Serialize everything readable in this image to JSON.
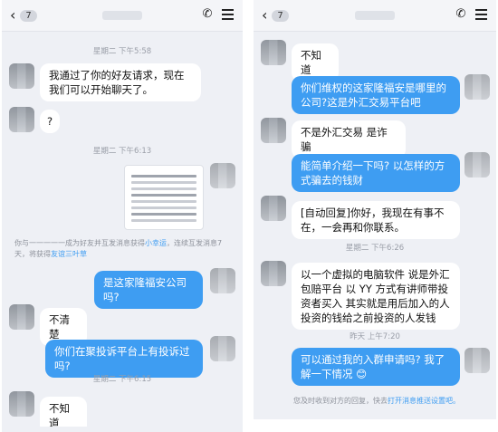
{
  "left": {
    "header": {
      "back_count": "7"
    },
    "timestamps": [
      "星期二 下午5:58",
      "星期二 下午6:13",
      "星期二 下午6:15"
    ],
    "messages": [
      "我通过了你的好友请求，现在我们可以开始聊天了。",
      "?",
      "是这家隆福安公司吗?",
      "不清楚",
      "你们在聚投诉平台上有投诉过吗?",
      "不知道"
    ],
    "system_note": {
      "prefix": "你与一一一一一成为好友并互发消息获得",
      "link1": "小幸运",
      "middle": "，连续互发消息7天，将获得",
      "link2": "友谊三叶草"
    }
  },
  "right": {
    "header": {
      "back_count": "7"
    },
    "timestamps": [
      "星期二 下午6:26",
      "昨天 上午7:20"
    ],
    "messages": [
      "不知道",
      "你们维权的这家隆福安是哪里的公司?这是外汇交易平台吧",
      "不是外汇交易 是诈骗",
      "能简单介绍一下吗? 以怎样的方式骗去的钱财",
      "[自动回复]你好，我现在有事不在，一会再和你联系。",
      "以一个虚拟的电脑软件 说是外汇包赔平台 以 YY 方式有讲师带投资者买入 其实就是用后加入的人投资的钱给之前投资的人发钱",
      "可以通过我的入群申请吗? 我了解一下情况 😊"
    ],
    "system_note": {
      "prefix": "您及时收到对方的回复，快去",
      "link": "打开消息推送设置吧。"
    }
  }
}
